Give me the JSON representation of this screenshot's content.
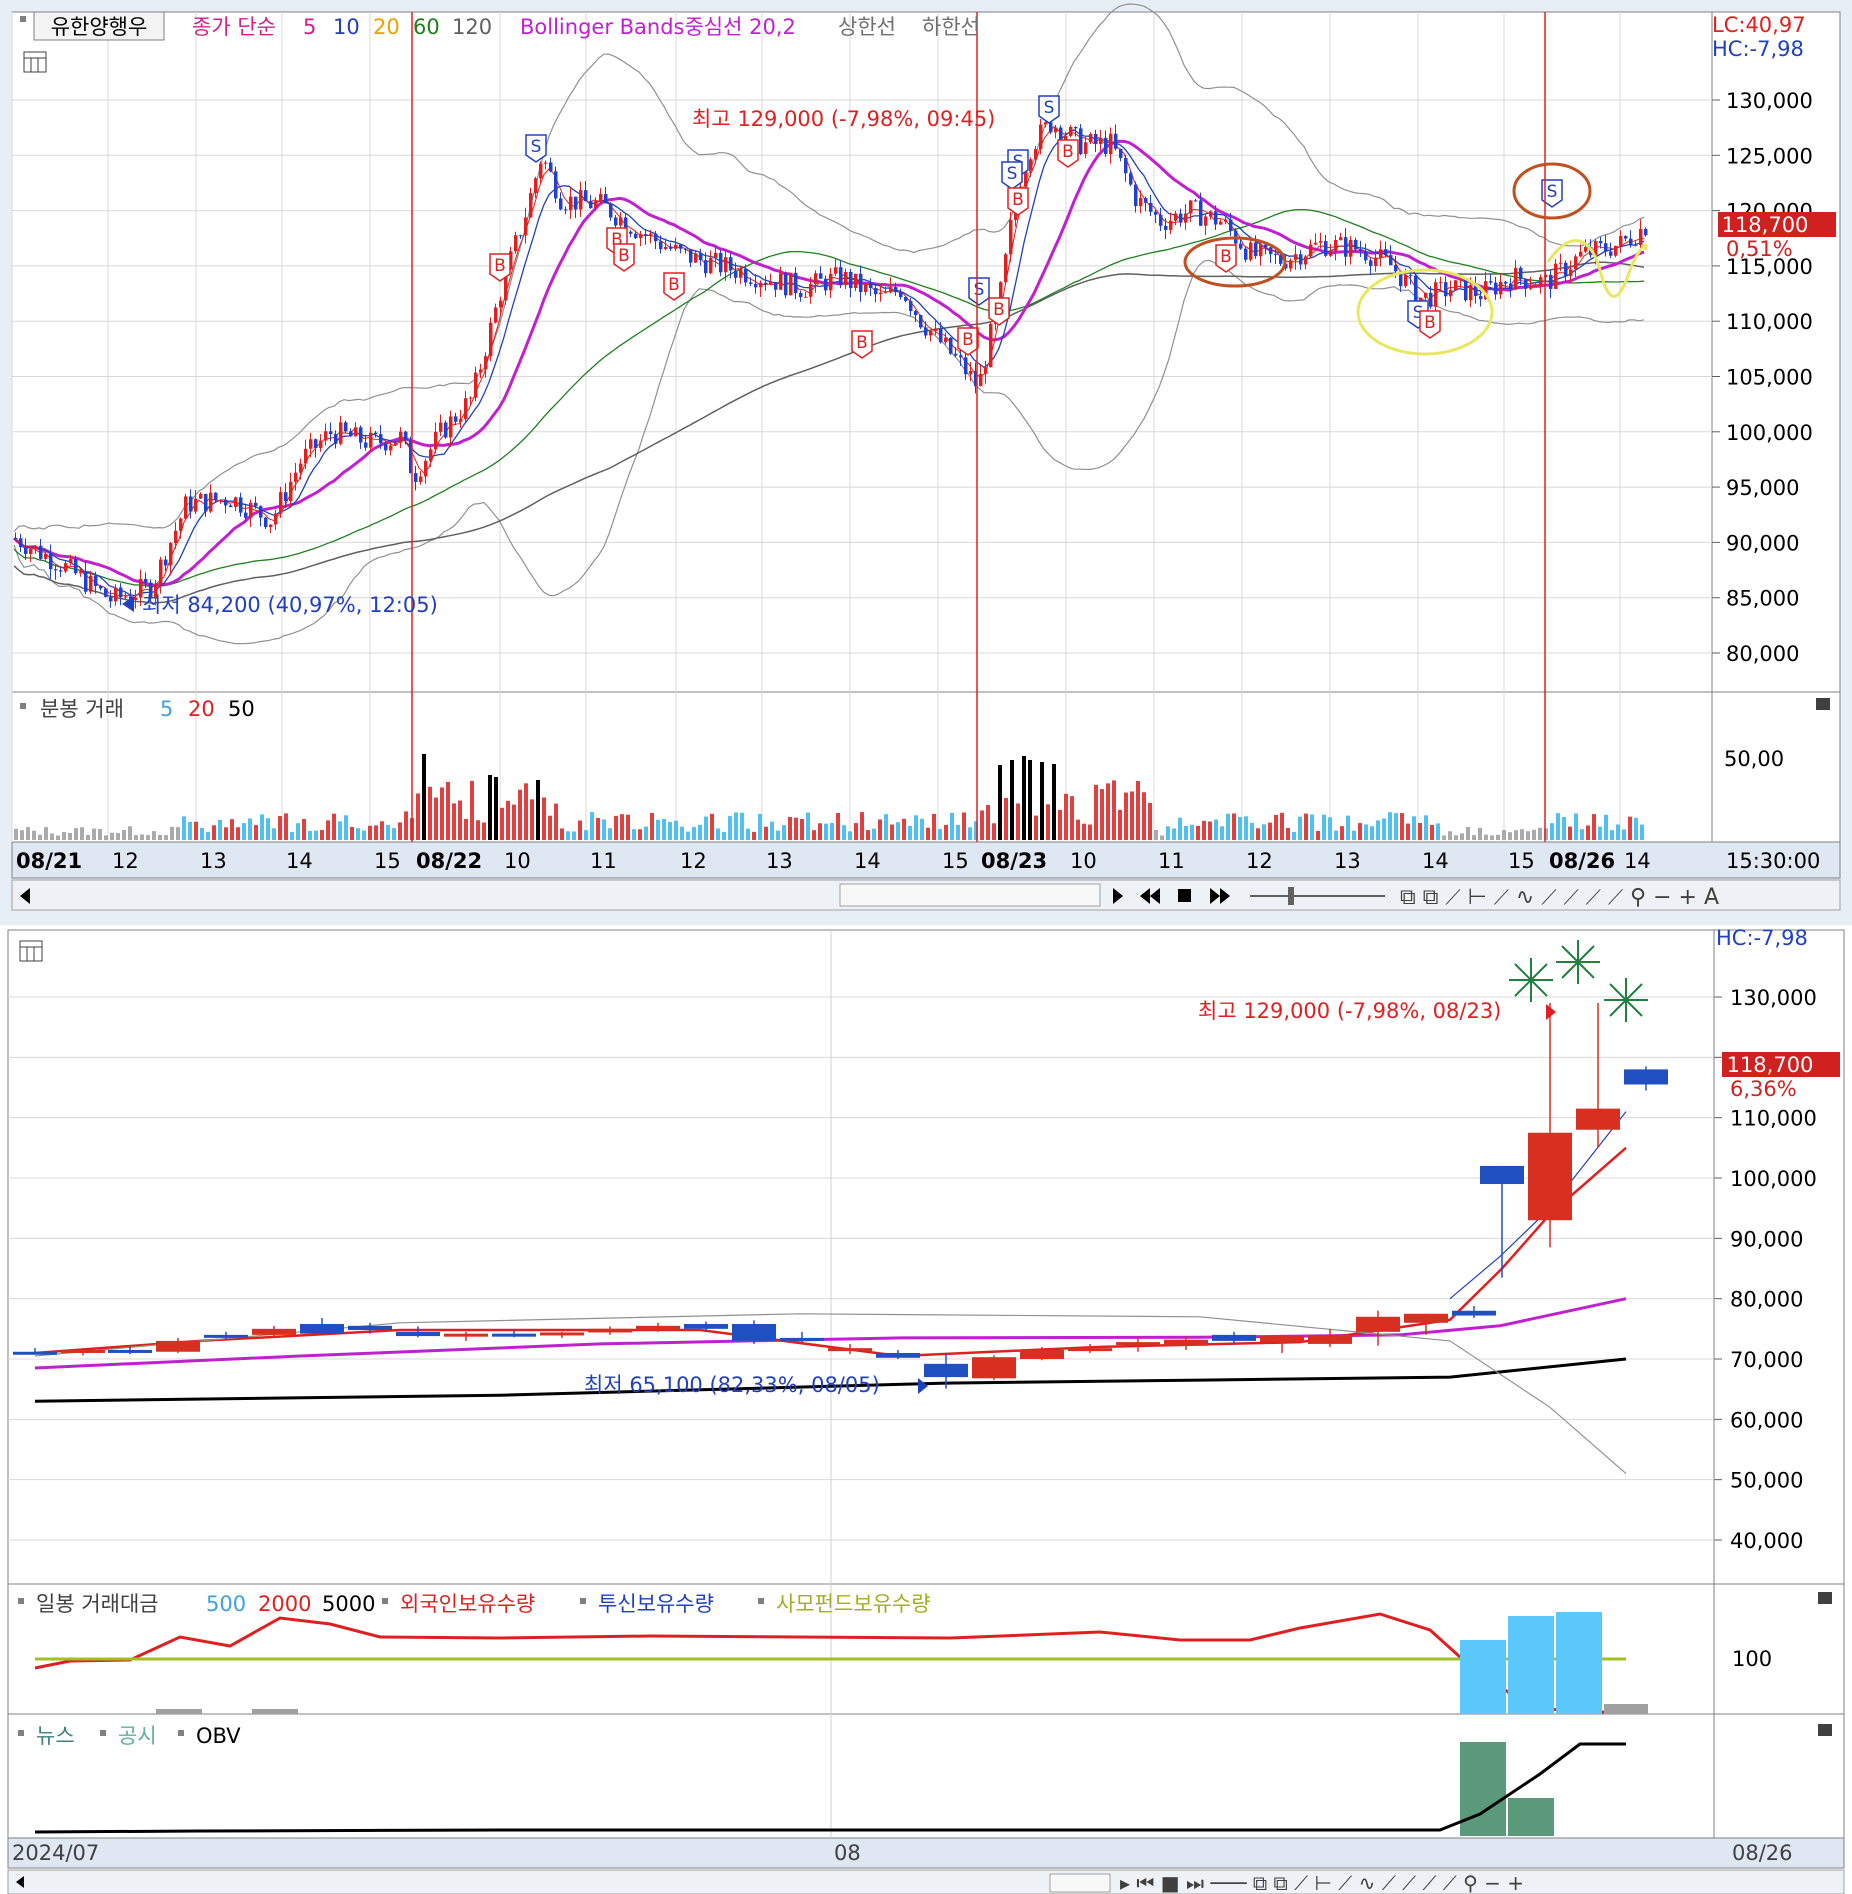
{
  "top_panel": {
    "symbol": "유한양행우",
    "legend": {
      "ma_label": "종가 단순",
      "ma_periods": [
        "5",
        "10",
        "20",
        "60",
        "120"
      ],
      "ma_colors": [
        "#d02090",
        "#2040c0",
        "#f0a000",
        "#208020",
        "#606060"
      ],
      "bb_label": "Bollinger Bands중심선 20,2",
      "upper_label": "상한선",
      "lower_label": "하한선"
    },
    "lc_label": "LC:40,97",
    "hc_label": "HC:-7,98",
    "price_box": "118,700",
    "price_pct": "0,51%",
    "y_ticks": [
      "130,000",
      "125,000",
      "120,000",
      "115,000",
      "110,000",
      "105,000",
      "100,000",
      "95,000",
      "90,000",
      "85,000",
      "80,000"
    ],
    "high_annotation": "최고 129,000 (-7,98%, 09:45)",
    "low_annotation": "최저 84,200 (40,97%, 12:05)",
    "volume_legend": {
      "label": "분봉 거래",
      "p1": "5",
      "p2": "20",
      "p3": "50"
    },
    "volume_tick": "50,00",
    "x_labels": [
      "08/21",
      "12",
      "13",
      "14",
      "15",
      "08/22",
      "10",
      "11",
      "12",
      "13",
      "14",
      "15",
      "08/23",
      "10",
      "11",
      "12",
      "13",
      "14",
      "15",
      "08/26",
      "14"
    ],
    "time_label": "15:30:00",
    "signals": [
      "S",
      "S",
      "S",
      "S",
      "S",
      "S",
      "S",
      "B",
      "B",
      "B",
      "B",
      "B",
      "B",
      "B",
      "B",
      "B",
      "B"
    ]
  },
  "bottom_panel": {
    "hc_label": "HC:-7,98",
    "price_box": "118,700",
    "price_pct": "6,36%",
    "y_ticks": [
      "130,000",
      "120,000",
      "110,000",
      "100,000",
      "90,000",
      "80,000",
      "70,000",
      "60,000",
      "50,000",
      "40,000"
    ],
    "high_annotation": "최고 129,000 (-7,98%, 08/23)",
    "low_annotation": "최저 65,100 (82,33%, 08/05)",
    "legend1": {
      "label": "일봉 거래대금",
      "p1": "500",
      "p2": "2000",
      "p3": "5000",
      "s1": "외국인보유수량",
      "s2": "투신보유수량",
      "s3": "사모펀드보유수량"
    },
    "legend1_tick": "100",
    "legend2": {
      "s1": "뉴스",
      "s2": "공시",
      "s3": "OBV"
    },
    "x_labels": [
      "2024/07",
      "08",
      "08/26"
    ]
  },
  "chart_data": [
    {
      "type": "candlestick",
      "title": "유한양행우 minute chart",
      "x": [
        "08/21",
        "08/22",
        "08/23",
        "08/26"
      ],
      "ylim": [
        78000,
        135000
      ],
      "high": 129000,
      "low": 84200,
      "last": 118700,
      "volume_ylim": [
        0,
        80
      ],
      "bands": {
        "upper_label": "상한선",
        "lower_label": "하한선"
      }
    },
    {
      "type": "candlestick",
      "title": "유한양행우 daily chart",
      "x": [
        "2024/07",
        "08",
        "08/26"
      ],
      "ylim": [
        35000,
        135000
      ],
      "high": 129000,
      "low": 65100,
      "last": 118700
    }
  ]
}
